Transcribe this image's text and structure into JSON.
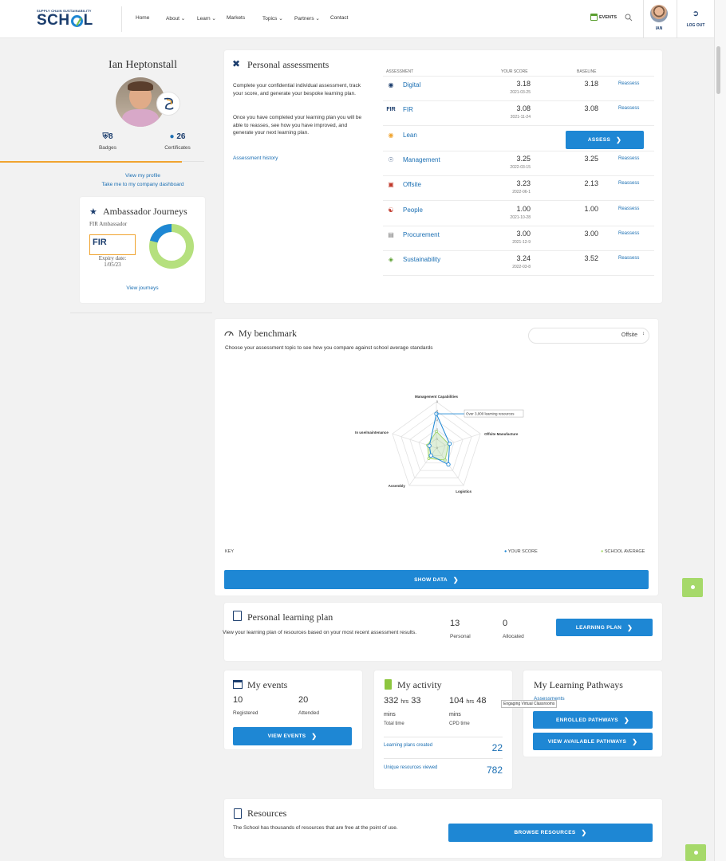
{
  "brand": {
    "tagline": "SUPPLY CHAIN SUSTAINABILITY",
    "name": "SCH",
    "name_end": "L"
  },
  "nav": {
    "items": [
      {
        "label": "Home"
      },
      {
        "label": "About ⌄"
      },
      {
        "label": "Learn ⌄"
      },
      {
        "label": "Markets"
      },
      {
        "label": "Topics ⌄"
      },
      {
        "label": "Partners ⌄"
      },
      {
        "label": "Contact"
      }
    ],
    "events_label": "EVENTS",
    "user_label": "IAN",
    "logout_label": "LOG OUT"
  },
  "profile": {
    "name": "Ian Heptonstall",
    "badges_count": "8",
    "badges_label": "Badges",
    "certificates_count": "26",
    "certificates_label": "Certificates",
    "view_profile": "View my profile",
    "company_dashboard": "Take me to my company dashboard"
  },
  "ambassador": {
    "title": "Ambassador Journeys",
    "subtitle": "FIR Ambassador",
    "logo_text": "FIR",
    "expiry_label": "Expiry date:",
    "expiry_date": "1/05/23",
    "view_journeys": "View journeys"
  },
  "assessments": {
    "title": "Personal assessments",
    "desc1": "Complete your confidential individual assessment, track your score, and generate your bespoke learning plan.",
    "desc2": "Once you have completed your learning plan you will be able to reasses, see how you have improved, and generate your next learning plan.",
    "history_link": "Assessment history",
    "col_assessment": "ASSESSMENT",
    "col_score": "YOUR SCORE",
    "col_baseline": "BASELINE",
    "assess_button": "ASSESS",
    "rows": [
      {
        "name": "Digital",
        "icon": "chip-icon",
        "score": "3.18",
        "date": "2021-03-25",
        "baseline": "3.18",
        "action": "Reassess"
      },
      {
        "name": "FIR",
        "icon": "fir-logo-icon",
        "score": "3.08",
        "date": "2021-11-24",
        "baseline": "3.08",
        "action": "Reassess"
      },
      {
        "name": "Lean",
        "icon": "lean-icon",
        "score": "",
        "date": "",
        "baseline": "",
        "action": ""
      },
      {
        "name": "Management",
        "icon": "person-icon",
        "score": "3.25",
        "date": "2022-03-15",
        "baseline": "3.25",
        "action": "Reassess"
      },
      {
        "name": "Offsite",
        "icon": "factory-icon",
        "score": "3.23",
        "date": "2022-06-1",
        "baseline": "2.13",
        "action": "Reassess"
      },
      {
        "name": "People",
        "icon": "people-icon",
        "score": "1.00",
        "date": "2021-10-28",
        "baseline": "1.00",
        "action": "Reassess"
      },
      {
        "name": "Procurement",
        "icon": "document-icon",
        "score": "3.00",
        "date": "2021-12-9",
        "baseline": "3.00",
        "action": "Reassess"
      },
      {
        "name": "Sustainability",
        "icon": "leaf-icon",
        "score": "3.24",
        "date": "2022-03-8",
        "baseline": "3.52",
        "action": "Reassess"
      }
    ]
  },
  "benchmark": {
    "title": "My benchmark",
    "desc": "Choose your assessment topic to see how you compare against school average standards",
    "select_value": "Offsite",
    "tooltip": "Over 3,000 learning resources",
    "key_label": "KEY",
    "legend_your_score": "YOUR SCORE",
    "legend_school_avg": "SCHOOL AVERAGE",
    "show_data_button": "SHOW DATA",
    "colors": {
      "your_score": "#1e87d4",
      "school_average": "#a6d96a"
    }
  },
  "chart_data": {
    "type": "radar",
    "axes": [
      "Management Capabilities",
      "Offsite Manufacture",
      "Logistics",
      "Assembly",
      "In use/maintenance"
    ],
    "rmax": 5,
    "tick_labels": [
      "0",
      "1",
      "2",
      "3",
      "4",
      "5"
    ],
    "series": [
      {
        "name": "YOUR SCORE",
        "values": [
          3.7,
          1.5,
          2.2,
          1.0,
          0.8
        ]
      },
      {
        "name": "SCHOOL AVERAGE",
        "values": [
          1.8,
          1.4,
          1.6,
          1.4,
          1.0
        ]
      }
    ]
  },
  "learning_plan": {
    "title": "Personal learning plan",
    "desc": "View your learning plan of resources based on your most recent assessment results.",
    "personal_count": "13",
    "personal_label": "Personal",
    "allocated_count": "0",
    "allocated_label": "Allocated",
    "button": "LEARNING PLAN"
  },
  "events": {
    "title": "My events",
    "registered_count": "10",
    "registered_label": "Registered",
    "attended_count": "20",
    "attended_label": "Attended",
    "button": "VIEW EVENTS"
  },
  "activity": {
    "title": "My activity",
    "total_hrs": "332",
    "total_mins": "33",
    "total_label": "Total time",
    "cpd_hrs": "104",
    "cpd_mins": "48",
    "cpd_label": "CPD time",
    "hrs_unit": "hrs",
    "mins_unit": "mins",
    "plans_label": "Learning plans created",
    "plans_count": "22",
    "resources_label": "Unique resources viewed",
    "resources_count": "782"
  },
  "pathways": {
    "title": "My Learning Pathways",
    "link": "Assessments",
    "tooltip": "Engaging Virtual Classrooms",
    "enrolled_button": "ENROLLED PATHWAYS",
    "available_button": "VIEW AVAILABLE PATHWAYS"
  },
  "resources": {
    "title": "Resources",
    "desc": "The School has thousands of resources that are free at the point of use.",
    "button": "BROWSE RESOURCES"
  }
}
